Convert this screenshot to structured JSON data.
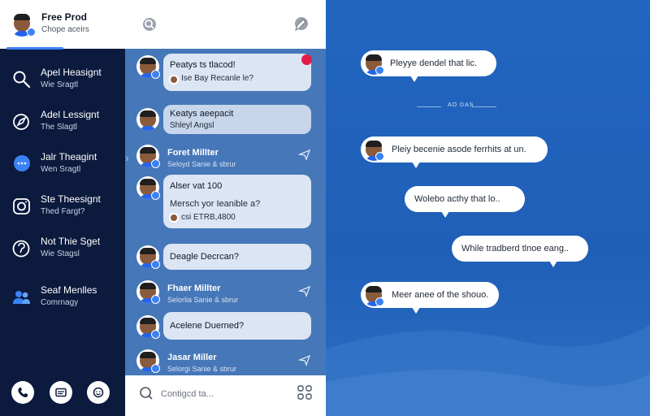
{
  "profile": {
    "name": "Free Prod",
    "status": "Chope aceirs"
  },
  "nav": [
    {
      "title": "Apel Heasignt",
      "sub": "Wie Sragtl",
      "icon": "search-icon"
    },
    {
      "title": "Adel Lessignt",
      "sub": "The Slagtl",
      "icon": "compass-icon"
    },
    {
      "title": "Jalr Theagint",
      "sub": "Wen Sragtl",
      "icon": "chat-icon"
    },
    {
      "title": "Ste Theesignt",
      "sub": "Thed Fargt?",
      "icon": "camera-icon"
    },
    {
      "title": "Not Thie Sget",
      "sub": "Wie Stagsl",
      "icon": "help-icon"
    },
    {
      "title": "Seaf Menlles",
      "sub": "Comrnagy",
      "icon": "contacts-icon"
    }
  ],
  "sidebar_buttons": [
    "phone-icon",
    "card-icon",
    "emoji-icon"
  ],
  "list": {
    "search_placeholder": "Contigcd ta...",
    "items": [
      {
        "type": "bubble",
        "t1": "Peatys ts tlacod!",
        "t2": "Ise Bay Recanle le?",
        "unread": true
      },
      {
        "type": "bubble",
        "t1": "Keatys aeepacit",
        "t2": "Shleyl Angsl"
      },
      {
        "type": "contact",
        "name": "Foret Millter",
        "sub": "Seloyd Sanie & sbrur"
      },
      {
        "type": "bubble3",
        "t1": "Alser vat 100",
        "t2": "Mersch yor Ieanible a?",
        "t3": "csi ETRB,4800"
      },
      {
        "type": "bubble1",
        "t1": "Deagle Decrcan?"
      },
      {
        "type": "contact",
        "name": "Fhaer Millter",
        "sub": "Selorlia Sanie & sbrur"
      },
      {
        "type": "bubble1",
        "t1": "Acelene Duerned?"
      },
      {
        "type": "contact",
        "name": "Jasar Miller",
        "sub": "Selorgi Sanie & sbrur"
      }
    ]
  },
  "chat": {
    "day_separator": "AO DAS",
    "messages": [
      {
        "text": "Pleyye dendel that lic.",
        "avatar": true
      },
      {
        "text": "Pleiy becenie asode ferrhits at un.",
        "avatar": true
      },
      {
        "text": "Wolebo acthy that lo..",
        "avatar": false
      },
      {
        "text": "While tradberd tlnoe eang..",
        "avatar": false
      },
      {
        "text": "Meer anee of the shouo.",
        "avatar": true
      }
    ]
  },
  "colors": {
    "sidebar": "#0b1a3d",
    "list_bg": "#4677b8",
    "chat_bg": "#1f5fb7",
    "accent": "#3b82f6",
    "unread": "#e11d48"
  }
}
